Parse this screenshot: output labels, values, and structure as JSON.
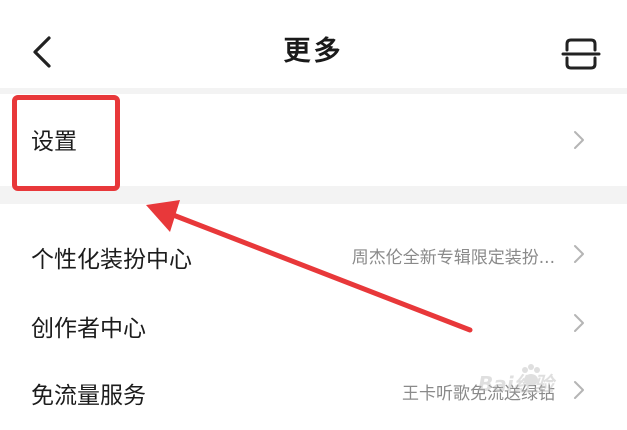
{
  "header": {
    "title": "更多",
    "back_icon": "chevron-left-icon",
    "scan_icon": "scan-icon"
  },
  "items": [
    {
      "label": "设置",
      "value": ""
    },
    {
      "label": "个性化装扮中心",
      "value": "周杰伦全新专辑限定装扮..."
    },
    {
      "label": "创作者中心",
      "value": ""
    },
    {
      "label": "免流量服务",
      "value": "王卡听歌免流送绿钻"
    }
  ],
  "annotation": {
    "highlight_color": "#e8383a",
    "arrow_color": "#e8383a"
  },
  "watermark": {
    "text": "Bai经验"
  },
  "colors": {
    "background": "#ffffff",
    "section_gap": "#f3f3f3",
    "text_primary": "#1c1c1c",
    "text_secondary": "#8a8a8a",
    "chevron": "#b5b5b5"
  }
}
